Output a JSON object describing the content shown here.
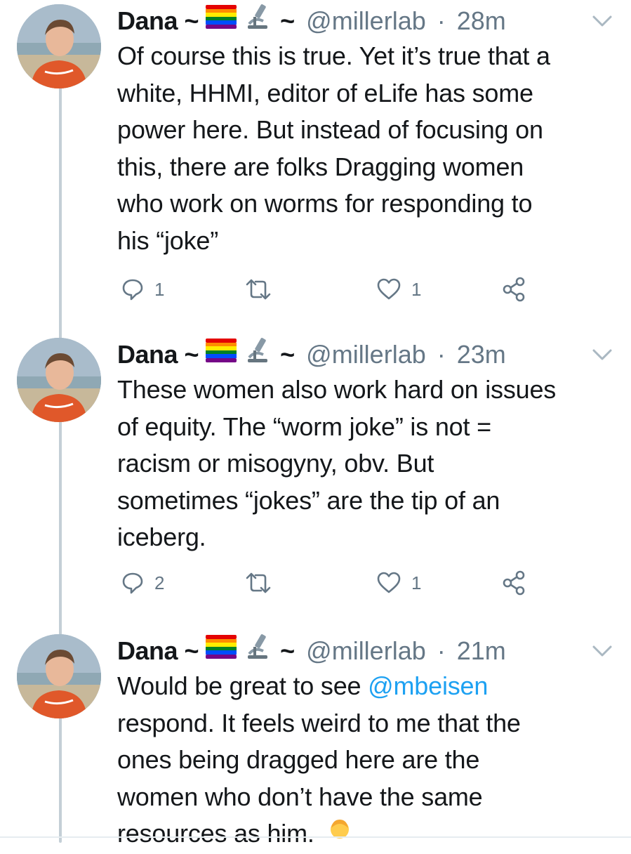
{
  "tweets": [
    {
      "name": "Dana ~",
      "tilde": "~",
      "handle": "@millerlab",
      "separator": "·",
      "time": "28m",
      "text_lines": [
        "Of course this is true. Yet it’s true that a",
        "white, HHMI, editor of eLife has some",
        "power here. But instead of focusing on",
        "this, there are folks Dragging women",
        "who work on worms for responding to",
        "his “joke”"
      ],
      "reply_count": "1",
      "like_count": "1"
    },
    {
      "name": "Dana ~",
      "tilde": "~",
      "handle": "@millerlab",
      "separator": "·",
      "time": "23m",
      "text_lines": [
        "These women also work hard on issues",
        "of equity. The “worm joke” is not =",
        "racism or misogyny, obv. But",
        "sometimes “jokes” are the tip of an",
        "iceberg."
      ],
      "reply_count": "2",
      "like_count": "1"
    },
    {
      "name": "Dana ~",
      "tilde": "~",
      "handle": "@millerlab",
      "separator": "·",
      "time": "21m",
      "text_line1_prefix": "Would be great to see ",
      "mention": "@mbeisen",
      "text_lines": [
        "respond. It feels weird to me that the",
        "ones being dragged here are the",
        "women who don’t have the same",
        "resources as him."
      ]
    }
  ],
  "icons": {
    "reply": "speech-bubble-icon",
    "retweet": "retweet-arrows-icon",
    "like": "heart-outline-icon",
    "share": "share-nodes-icon",
    "more": "chevron-down-icon",
    "pride_flag": "rainbow-flag-emoji",
    "microscope": "microscope-emoji",
    "person": "person-emoji"
  },
  "colors": {
    "text": "#14171a",
    "secondary": "#657786",
    "link": "#1da1f2",
    "thread_line": "#c4cfd6"
  }
}
